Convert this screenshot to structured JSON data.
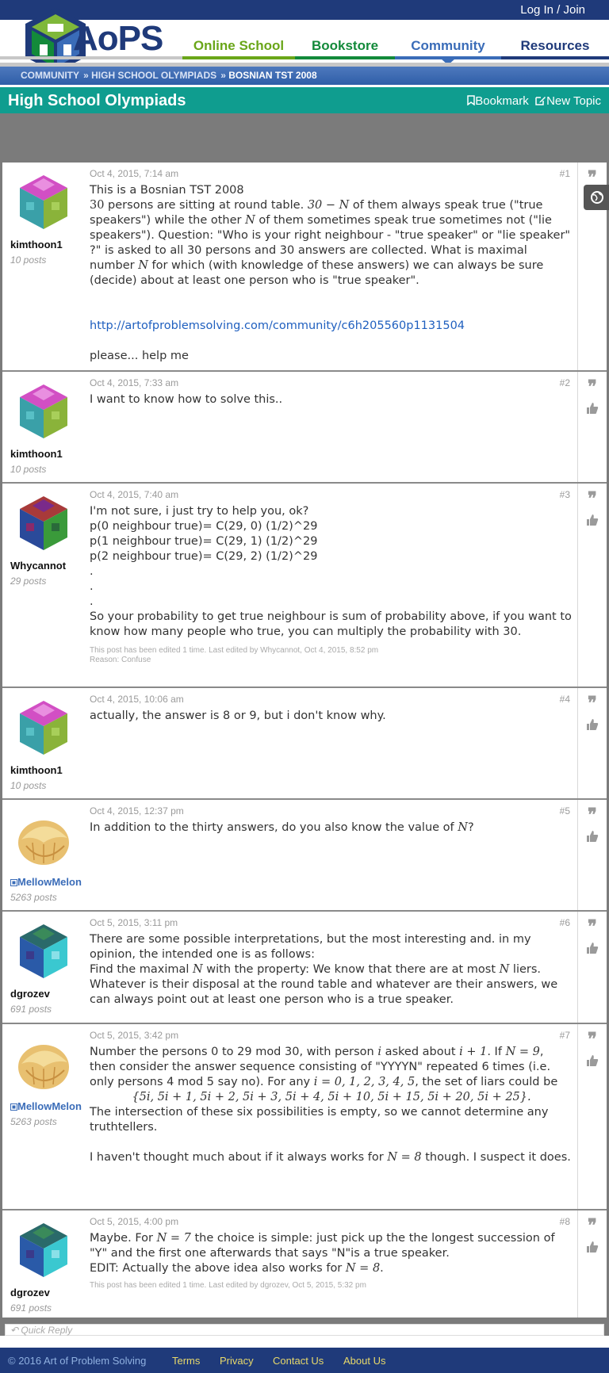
{
  "header": {
    "login": "Log In / Join",
    "logo": "AoPS",
    "nav": [
      "Online School",
      "Bookstore",
      "Community",
      "Resources"
    ],
    "colors": {
      "online_school": "#6aa619",
      "bookstore": "#138a3a",
      "community": "#3a6cb8",
      "resources": "#1f3a7a"
    }
  },
  "breadcrumb": [
    "COMMUNITY",
    "HIGH SCHOOL OLYMPIADS",
    "BOSNIAN TST 2008"
  ],
  "forum": {
    "title": "High School Olympiads",
    "bookmark": "Bookmark",
    "new_topic": "New Topic"
  },
  "posts": [
    {
      "date": "Oct 4, 2015, 7:14 am",
      "num": "#1",
      "user": "kimthoon1",
      "posts": "10 posts",
      "line1": "This is a Bosnian TST 2008",
      "p1a": "30",
      "p1b": " persons are sitting at round table. ",
      "p1c": "30 − N",
      "p1d": " of them always speak true (\"true speakers\") while the other ",
      "p1e": "N",
      "p1f": " of them sometimes speak true sometimes not (\"lie speakers\"). Question: \"Who is your right neighbour - \"true speaker\" or \"lie speaker\" ?\" is asked to all 30 persons and 30 answers are collected. What is maximal number ",
      "p1g": "N",
      "p1h": " for which (with knowledge of these answers) we can always be sure (decide) about at least one person who is \"true speaker\".",
      "link": "http://artofproblemsolving.com/community/c6h205560p1131504",
      "last": "please... help me"
    },
    {
      "date": "Oct 4, 2015, 7:33 am",
      "num": "#2",
      "user": "kimthoon1",
      "posts": "10 posts",
      "text": "I want to know how to solve this.."
    },
    {
      "date": "Oct 4, 2015, 7:40 am",
      "num": "#3",
      "user": "Whycannot",
      "posts": "29 posts",
      "l1": "I'm not sure, i just try to help you, ok?",
      "l2": "p(0 neighbour true)= C(29, 0) (1/2)^29",
      "l3": "p(1 neighbour true)= C(29, 1) (1/2)^29",
      "l4": "p(2 neighbour true)= C(29, 2) (1/2)^29",
      "dot": ".",
      "l5": "So your probability to get true neighbour is sum of probability above, if you want to know how many people who true, you can multiply the probability with 30.",
      "edit1": "This post has been edited 1 time. Last edited by Whycannot, Oct 4, 2015, 8:52 pm",
      "edit2": "Reason: Confuse"
    },
    {
      "date": "Oct 4, 2015, 10:06 am",
      "num": "#4",
      "user": "kimthoon1",
      "posts": "10 posts",
      "text": "actually, the answer is 8 or 9, but i don't know why."
    },
    {
      "date": "Oct 4, 2015, 12:37 pm",
      "num": "#5",
      "user": "MellowMelon",
      "posts": "5263 posts",
      "t1": "In addition to the thirty answers, do you also know the value of ",
      "t2": "N",
      "t3": "?"
    },
    {
      "date": "Oct 5, 2015, 3:11 pm",
      "num": "#6",
      "user": "dgrozev",
      "posts": "691 posts",
      "a": "There are some possible interpretations, but the most interesting and. in my opinion, the intended one is as follows:",
      "b1": "Find the maximal ",
      "b2": "N",
      "b3": " with the property: We know that there are at most ",
      "b4": "N",
      "b5": " liers. Whatever is their disposal at the round table and whatever are their answers, we can always point out at least one person who is a true speaker."
    },
    {
      "date": "Oct 5, 2015, 3:42 pm",
      "num": "#7",
      "user": "MellowMelon",
      "posts": "5263 posts",
      "a1": "Number the persons 0 to 29 mod 30, with person ",
      "a2": "i",
      "a3": " asked about ",
      "a4": "i + 1",
      "a5": ". If ",
      "a6": "N = 9",
      "a7": ", then consider the answer sequence consisting of \"YYYYN\" repeated 6 times (i.e. only persons 4 mod 5 say no). For any ",
      "a8": "i = 0, 1, 2, 3, 4, 5",
      "a9": ", the set of liars could be",
      "display": "{5i, 5i + 1, 5i + 2, 5i + 3, 5i + 4, 5i + 10, 5i + 15, 5i + 20, 5i + 25}.",
      "b": "The intersection of these six possibilities is empty, so we cannot determine any truthtellers.",
      "c1": "I haven't thought much about if it always works for ",
      "c2": "N = 8",
      "c3": " though. I suspect it does."
    },
    {
      "date": "Oct 5, 2015, 4:00 pm",
      "num": "#8",
      "user": "dgrozev",
      "posts": "691 posts",
      "a1": "Maybe. For ",
      "a2": "N = 7",
      "a3": " the choice is simple: just pick up the the longest succession of \"Y\" and the first one afterwards that says \"N\"is a true speaker.",
      "b1": "EDIT: Actually the above idea also works for ",
      "b2": "N = 8",
      "b3": ".",
      "edit": "This post has been edited 1 time. Last edited by dgrozev, Oct 5, 2015, 5:32 pm"
    }
  ],
  "quick_reply": "Quick Reply",
  "footer": {
    "copyright": "© 2016 Art of Problem Solving",
    "links": [
      "Terms",
      "Privacy",
      "Contact Us",
      "About Us"
    ]
  },
  "icons": [
    "quote-icon",
    "thumbs-up-icon",
    "globe-icon",
    "bookmark-icon",
    "edit-icon",
    "reply-icon",
    "moderator-icon"
  ]
}
